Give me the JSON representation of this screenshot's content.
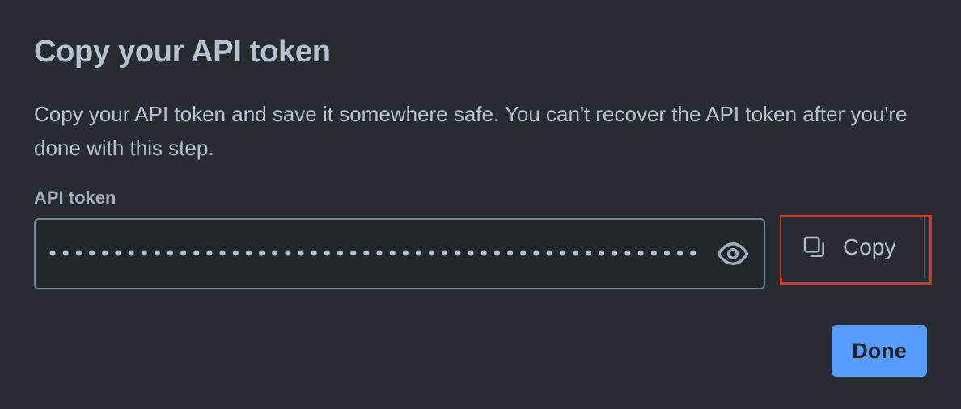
{
  "dialog": {
    "title": "Copy your API token",
    "description": "Copy your API token and save it somewhere safe. You can't recover the API token after you're done with this step."
  },
  "token_field": {
    "label": "API token",
    "masked_value": "••••••••••••••••••••••••••••••••••••••••••••••••••••",
    "toggle_icon": "eye-icon"
  },
  "copy_button": {
    "label": "Copy",
    "icon": "copy-icon",
    "highlight_color": "#e0321a"
  },
  "done_button": {
    "label": "Done",
    "color": "#579dff"
  }
}
